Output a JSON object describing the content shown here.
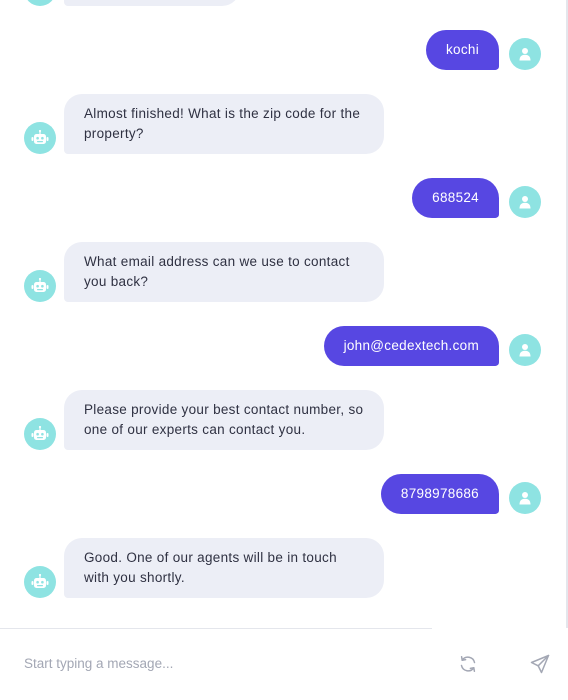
{
  "colors": {
    "user_bubble": "#5747e2",
    "bot_bubble": "#eceef6",
    "avatar": "#8ee3e2",
    "text": "#2f3142",
    "placeholder": "#a3a7b4"
  },
  "messages": [
    {
      "sender": "user",
      "text": "kochi",
      "avatar_icon": "user-icon"
    },
    {
      "sender": "bot",
      "text": "Almost finished! What is the zip code for the property?",
      "avatar_icon": "robot-icon"
    },
    {
      "sender": "user",
      "text": "688524",
      "avatar_icon": "user-icon"
    },
    {
      "sender": "bot",
      "text": "What email address can we use to contact you back?",
      "avatar_icon": "robot-icon"
    },
    {
      "sender": "user",
      "text": "john@cedextech.com",
      "avatar_icon": "user-icon"
    },
    {
      "sender": "bot",
      "text": "Please provide your best contact number, so one of our experts can contact you.",
      "avatar_icon": "robot-icon"
    },
    {
      "sender": "user",
      "text": "8798978686",
      "avatar_icon": "user-icon"
    },
    {
      "sender": "bot",
      "text": "Good. One of our agents will be in touch with you shortly.",
      "avatar_icon": "robot-icon"
    }
  ],
  "composer": {
    "placeholder": "Start typing a message...",
    "value": "",
    "refresh_icon": "refresh-icon",
    "send_icon": "send-icon"
  }
}
